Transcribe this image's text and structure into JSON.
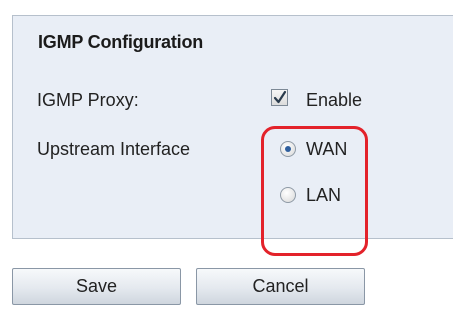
{
  "section": {
    "title": "IGMP Configuration"
  },
  "igmp_proxy": {
    "label": "IGMP Proxy:",
    "checkbox_label": "Enable",
    "checked": true
  },
  "upstream_interface": {
    "label": "Upstream Interface",
    "options": [
      {
        "label": "WAN",
        "selected": true
      },
      {
        "label": "LAN",
        "selected": false
      }
    ]
  },
  "buttons": {
    "save_label": "Save",
    "cancel_label": "Cancel"
  },
  "colors": {
    "panel_background": "#e9eef6",
    "highlight": "#e3222a",
    "radio_selected": "#2f5f9e"
  }
}
